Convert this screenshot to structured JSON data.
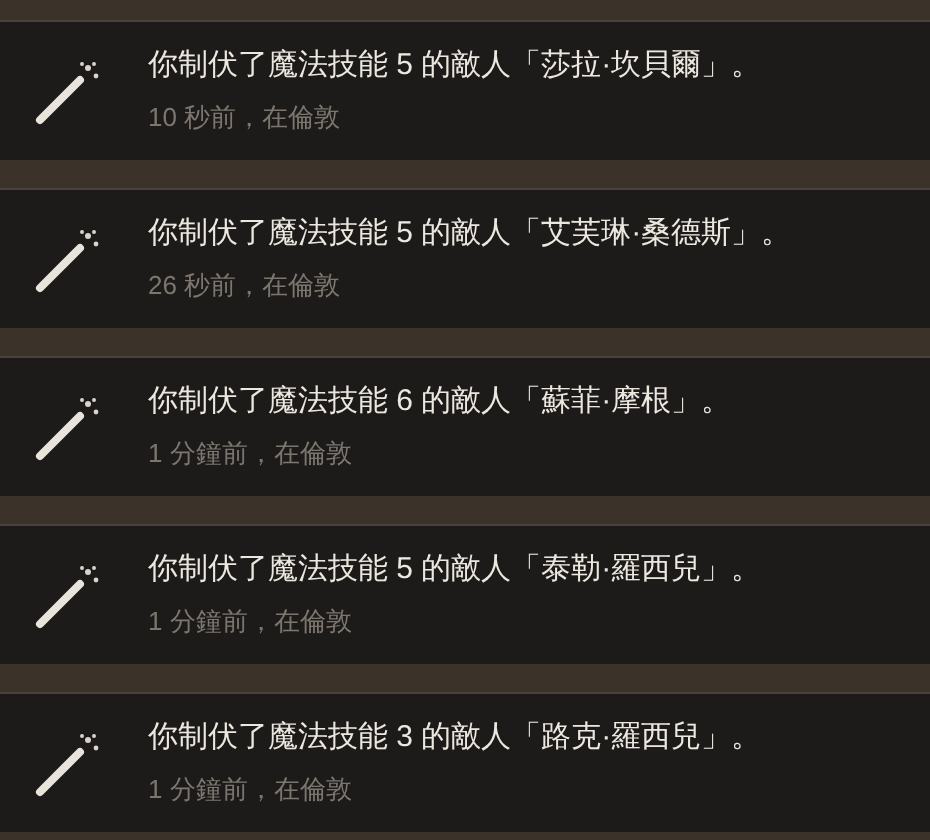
{
  "notifications": [
    {
      "message": "你制伏了魔法技能 5 的敵人「莎拉·坎貝爾」。",
      "meta": "10 秒前，在倫敦"
    },
    {
      "message": "你制伏了魔法技能 5 的敵人「艾芙琳·桑德斯」。",
      "meta": "26 秒前，在倫敦"
    },
    {
      "message": "你制伏了魔法技能 6 的敵人「蘇菲·摩根」。",
      "meta": "1 分鐘前，在倫敦"
    },
    {
      "message": "你制伏了魔法技能 5 的敵人「泰勒·羅西兒」。",
      "meta": "1 分鐘前，在倫敦"
    },
    {
      "message": "你制伏了魔法技能 3 的敵人「路克·羅西兒」。",
      "meta": "1 分鐘前，在倫敦"
    }
  ]
}
